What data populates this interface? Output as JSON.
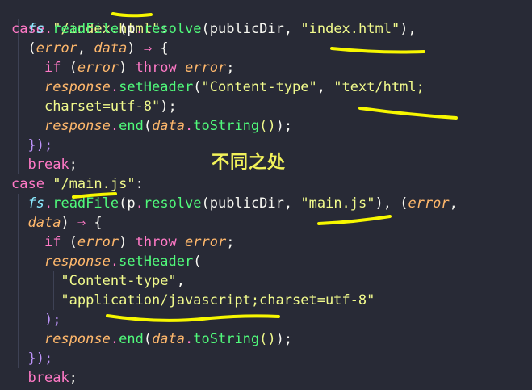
{
  "code": {
    "l1_case": "case",
    "l1_str": "\"/index.html\"",
    "l1_colon": ":",
    "l2_fs": "fs",
    "l2_dot": ".",
    "l2_fn": "readFile",
    "l2_open": "(",
    "l2_p": "p",
    "l2_dot2": ".",
    "l2_resolve": "resolve",
    "l2_open2": "(",
    "l2_dir": "publicDir",
    "l2_comma": ", ",
    "l2_str": "\"index.html\"",
    "l2_close": "),",
    "l3_open": "(",
    "l3_err": "error",
    "l3_comma": ", ",
    "l3_data": "data",
    "l3_close": ")",
    "l3_arrow": " ⇒ ",
    "l3_brace": "{",
    "l4_if": "if",
    "l4_open": " (",
    "l4_err": "error",
    "l4_close": ") ",
    "l4_throw": "throw",
    "l4_err2": " error",
    "l4_semi": ";",
    "l5_resp": "response",
    "l5_dot": ".",
    "l5_fn": "setHeader",
    "l5_open": "(",
    "l5_s1": "\"Content-type\"",
    "l5_comma": ", ",
    "l5_s2": "\"text/html;",
    "l6_s": "charset=utf-8\"",
    "l6_close": ");",
    "l7_resp": "response",
    "l7_dot": ".",
    "l7_fn": "end",
    "l7_open": "(",
    "l7_data": "data",
    "l7_dot2": ".",
    "l7_fn2": "toString",
    "l7_call": "()",
    "l7_close": ");",
    "l8_close": "});",
    "l9_break": "break",
    "l9_semi": ";",
    "l10_case": "case",
    "l10_str": "\"/main.js\"",
    "l10_colon": ":",
    "l11_fs": "fs",
    "l11_dot": ".",
    "l11_fn": "readFile",
    "l11_open": "(",
    "l11_p": "p",
    "l11_dot2": ".",
    "l11_resolve": "resolve",
    "l11_open2": "(",
    "l11_dir": "publicDir",
    "l11_comma": ", ",
    "l11_str": "\"main.js\"",
    "l11_close": "), ",
    "l11_open3": "(",
    "l11_err": "error",
    "l11_comma2": ",",
    "l12_data": "data",
    "l12_close": ")",
    "l12_arrow": " ⇒ ",
    "l12_brace": "{",
    "l13_if": "if",
    "l13_open": " (",
    "l13_err": "error",
    "l13_close": ") ",
    "l13_throw": "throw",
    "l13_err2": " error",
    "l13_semi": ";",
    "l14_resp": "response",
    "l14_dot": ".",
    "l14_fn": "setHeader",
    "l14_open": "(",
    "l15_s": "\"Content-type\"",
    "l15_comma": ",",
    "l16_s": "\"application/javascript;charset=utf-8\"",
    "l17_close": ");",
    "l18_resp": "response",
    "l18_dot": ".",
    "l18_fn": "end",
    "l18_open": "(",
    "l18_data": "data",
    "l18_dot2": ".",
    "l18_fn2": "toString",
    "l18_call": "()",
    "l18_close": ");",
    "l19_close": "});",
    "l20_break": "break",
    "l20_semi": ";"
  },
  "annotation": {
    "text": "不同之处",
    "color": "#f2f25a"
  },
  "theme": {
    "background": "#282a36",
    "keyword": "#ff79c6",
    "string": "#f1fa8c",
    "function": "#50fa7b",
    "variable": "#8be9fd",
    "parameter": "#ffb86c"
  }
}
